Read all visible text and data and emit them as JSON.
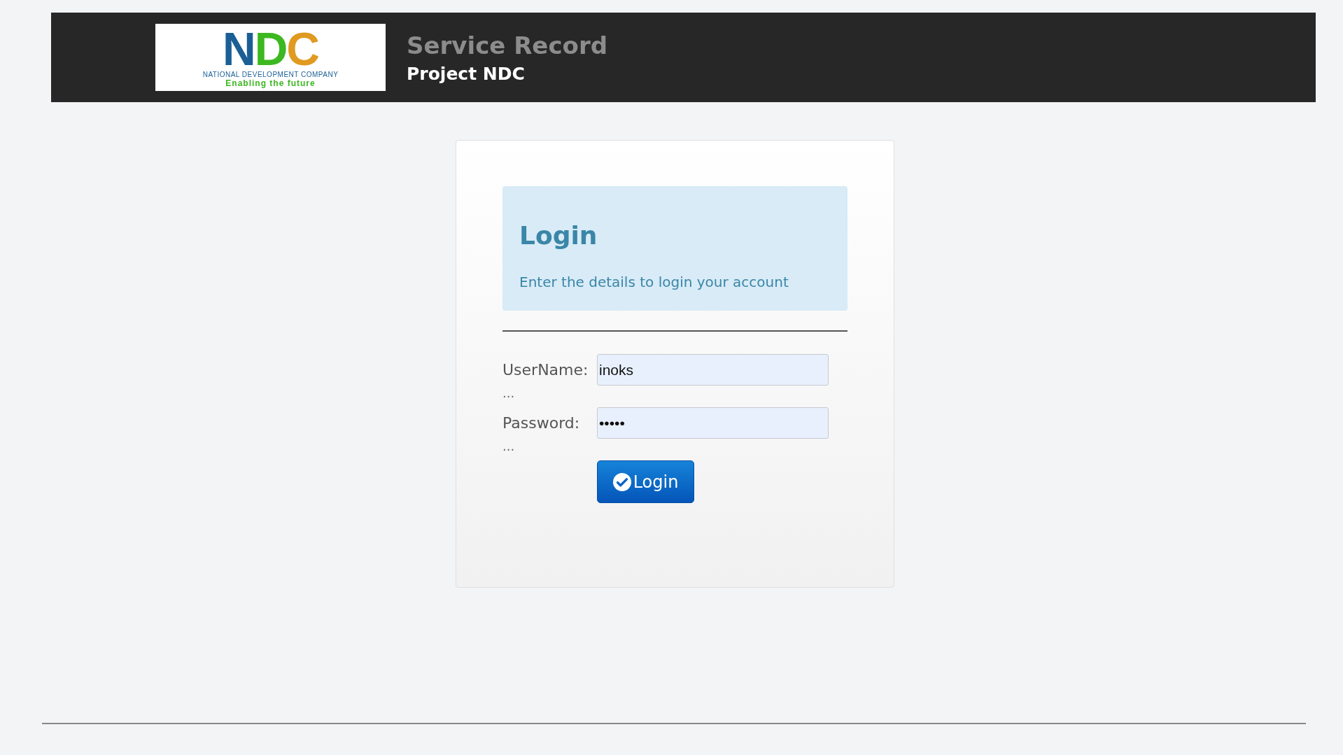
{
  "header": {
    "logo": {
      "letters": "NDC",
      "company": "NATIONAL DEVELOPMENT COMPANY",
      "tagline": "Enabling the future"
    },
    "title": "Service Record",
    "subtitle": "Project NDC"
  },
  "login": {
    "heading": "Login",
    "description": "Enter the details to login your account",
    "fields": [
      {
        "label": "UserName:",
        "value": "inoks",
        "note": "..."
      },
      {
        "label": "Password:",
        "value": "•••••",
        "note": "..."
      }
    ],
    "button": "Login"
  }
}
